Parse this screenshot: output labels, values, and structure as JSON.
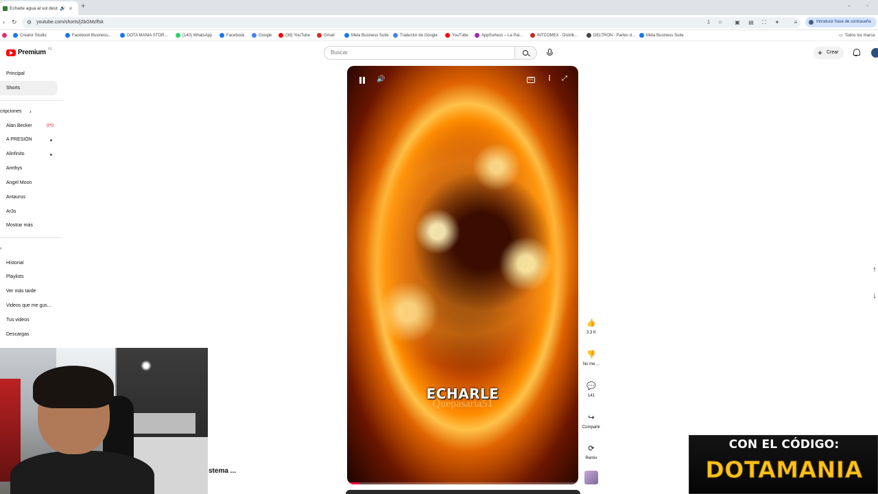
{
  "browser": {
    "tab_title": "Echarle agua al sol destr...",
    "new_tab": "+",
    "url": "youtube.com/shorts/j2bGMzffsk",
    "password_pill": "Introducir frase de contraseña",
    "all_bookmarks": "Todos los marca",
    "bookmarks": [
      {
        "label": "",
        "color": "#e1306c"
      },
      {
        "label": "Creator Studio",
        "color": "#1877f2"
      },
      {
        "label": "Facebook Business...",
        "color": "#1877f2"
      },
      {
        "label": "DOTA MANIA STOR...",
        "color": "#1877f2"
      },
      {
        "label": "(140) WhatsApp",
        "color": "#25d366"
      },
      {
        "label": "Facebook",
        "color": "#1877f2"
      },
      {
        "label": "Google",
        "color": "#4285f4"
      },
      {
        "label": "(39) YouTube",
        "color": "#ff0000"
      },
      {
        "label": "Gmail",
        "color": "#d93025"
      },
      {
        "label": "Meta Business Suite",
        "color": "#1877f2"
      },
      {
        "label": "Traductor de Google",
        "color": "#4285f4"
      },
      {
        "label": "YouTube",
        "color": "#ff0000"
      },
      {
        "label": "AppSorteos – La Pal...",
        "color": "#9c27b0"
      },
      {
        "label": "INTCOMEX - Distrib...",
        "color": "#c62828"
      },
      {
        "label": "DELTRON - Partes d...",
        "color": "#444444"
      },
      {
        "label": "Meta Business Suite",
        "color": "#1877f2"
      }
    ]
  },
  "youtube": {
    "logo_text": "Premium",
    "logo_sup": "PE",
    "search_placeholder": "Buscar",
    "create_label": "Crear"
  },
  "sidebar": {
    "main": [
      "Principal",
      "Shorts"
    ],
    "subscriptions_header": "cripciones",
    "subscriptions": [
      "Alan Becker",
      "A PRESIÓN",
      "Alinfinito",
      "Amthys",
      "Angel Moon",
      "Antaurus",
      "Ar3s",
      "Mostrar más"
    ],
    "you_header": "›",
    "you": [
      "Historial",
      "Playlists",
      "Ver más tarde",
      "Videos que me gus...",
      "Tus videos",
      "Descargas"
    ]
  },
  "player": {
    "caption_main": "ECHARLE",
    "caption_watermark": "Quepasaria51",
    "progress": 0.05
  },
  "actions": {
    "like_count": "3.3 K",
    "dislike_label": "No me ...",
    "comments_count": "141",
    "share_label": "Compartir",
    "remix_label": "Remix"
  },
  "overlays": {
    "cut_text": "stema ...",
    "promo_line1": "CON EL CÓDIGO:",
    "promo_line2": "DOTAMANIA"
  },
  "colors": {
    "youtube_red": "#ff0000",
    "promo_yellow": "#ffc21a"
  }
}
